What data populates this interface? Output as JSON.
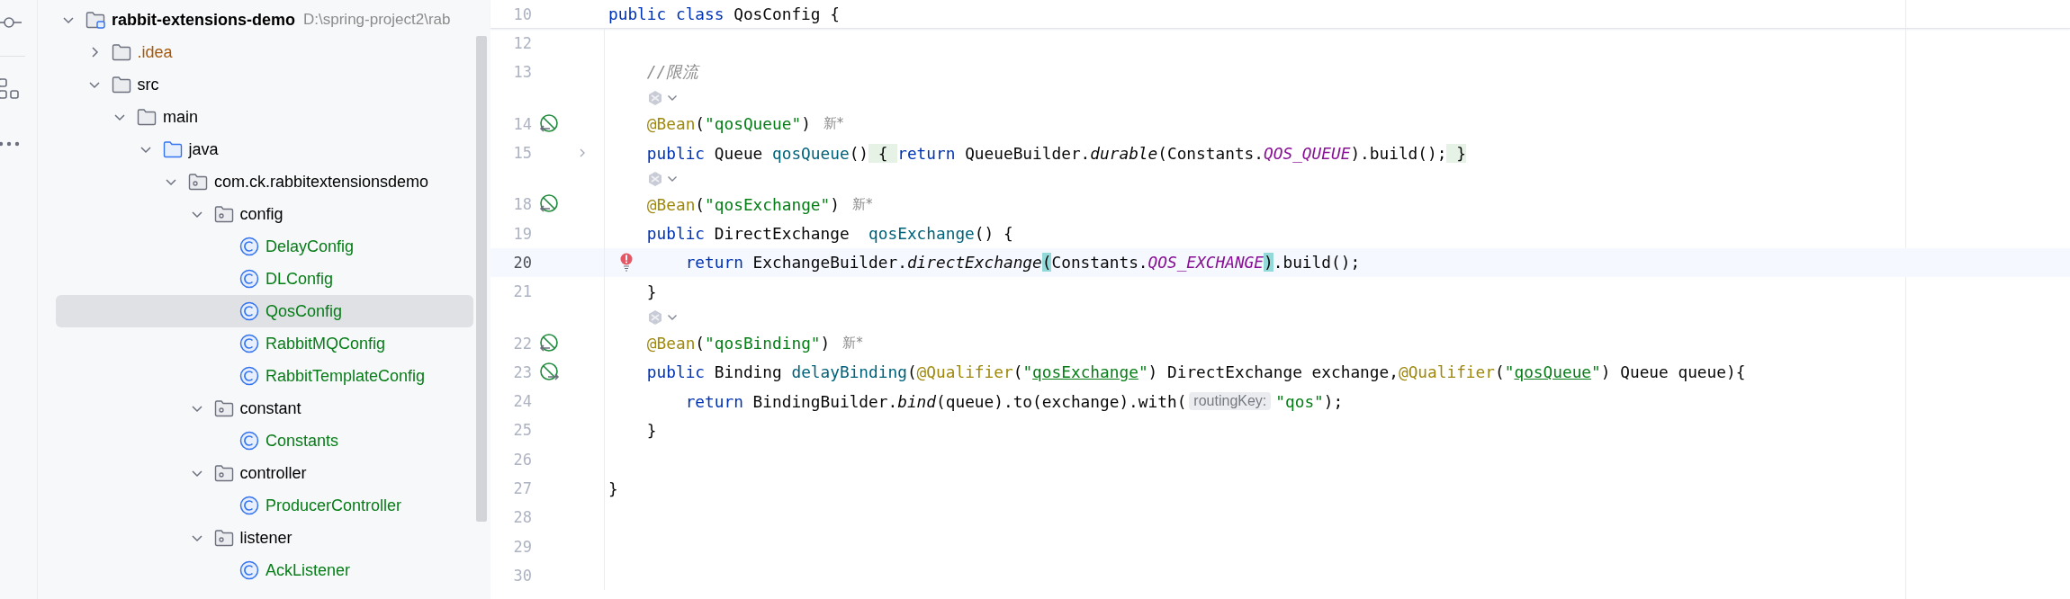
{
  "project_tree": {
    "root": {
      "name": "rabbit-extensions-demo",
      "path": "D:\\spring-project2\\rab",
      "kind": "module",
      "expanded": true,
      "selected": false,
      "children": [
        {
          "name": ".idea",
          "kind": "folder",
          "color": "#a6580a",
          "expanded": false,
          "selected": false
        },
        {
          "name": "src",
          "kind": "folder",
          "expanded": true,
          "selected": false,
          "children": [
            {
              "name": "main",
              "kind": "folder",
              "expanded": true,
              "selected": false,
              "children": [
                {
                  "name": "java",
                  "kind": "source-root",
                  "expanded": true,
                  "selected": false,
                  "children": [
                    {
                      "name": "com.ck.rabbitextensionsdemo",
                      "kind": "package",
                      "expanded": true,
                      "selected": false,
                      "children": [
                        {
                          "name": "config",
                          "kind": "package",
                          "expanded": true,
                          "selected": false,
                          "children": [
                            {
                              "name": "DelayConfig",
                              "kind": "class",
                              "color": "#067d17",
                              "selected": false
                            },
                            {
                              "name": "DLConfig",
                              "kind": "class",
                              "color": "#067d17",
                              "selected": false
                            },
                            {
                              "name": "QosConfig",
                              "kind": "class",
                              "color": "#067d17",
                              "selected": true
                            },
                            {
                              "name": "RabbitMQConfig",
                              "kind": "class",
                              "color": "#067d17",
                              "selected": false
                            },
                            {
                              "name": "RabbitTemplateConfig",
                              "kind": "class",
                              "color": "#067d17",
                              "selected": false
                            }
                          ]
                        },
                        {
                          "name": "constant",
                          "kind": "package",
                          "expanded": true,
                          "selected": false,
                          "children": [
                            {
                              "name": "Constants",
                              "kind": "class",
                              "color": "#067d17",
                              "selected": false
                            }
                          ]
                        },
                        {
                          "name": "controller",
                          "kind": "package",
                          "expanded": true,
                          "selected": false,
                          "children": [
                            {
                              "name": "ProducerController",
                              "kind": "class",
                              "color": "#067d17",
                              "selected": false
                            }
                          ]
                        },
                        {
                          "name": "listener",
                          "kind": "package",
                          "expanded": true,
                          "selected": false,
                          "children": [
                            {
                              "name": "AckListener",
                              "kind": "class",
                              "color": "#067d17",
                              "selected": false
                            }
                          ]
                        }
                      ]
                    }
                  ]
                }
              ]
            }
          ]
        }
      ]
    }
  },
  "editor": {
    "lines": [
      {
        "kind": "code",
        "number": "10",
        "sticky": true,
        "current": false,
        "folded": false,
        "tokens": [
          {
            "t": "public ",
            "kind": "kw"
          },
          {
            "t": "class ",
            "kind": "kw"
          },
          {
            "t": "QosConfig {",
            "kind": "id"
          }
        ]
      },
      {
        "kind": "code",
        "number": "12",
        "current": false,
        "folded": false
      },
      {
        "kind": "code",
        "number": "13",
        "current": false,
        "folded": false,
        "tokens": [
          {
            "t": "    //限流",
            "kind": "comment"
          }
        ]
      },
      {
        "kind": "inlay"
      },
      {
        "kind": "code",
        "number": "14",
        "marker": {
          "kind": "bean"
        },
        "current": false,
        "folded": false,
        "author": "新*",
        "tokens": [
          {
            "t": "    @Bean",
            "kind": "ann"
          },
          {
            "t": "(",
            "kind": "id"
          },
          {
            "t": "\"qosQueue\"",
            "kind": "str"
          },
          {
            "t": ")",
            "kind": "id"
          }
        ]
      },
      {
        "kind": "code",
        "number": "15",
        "current": false,
        "folded": true,
        "tokens": [
          {
            "t": "    public ",
            "kind": "kw"
          },
          {
            "t": "Queue ",
            "kind": "id"
          },
          {
            "t": "qosQueue",
            "kind": "fn"
          },
          {
            "t": "()",
            "kind": "id"
          },
          {
            "t": " { ",
            "kind": "brace"
          },
          {
            "t": "return ",
            "kind": "kw"
          },
          {
            "t": "QueueBuilder.",
            "kind": "id"
          },
          {
            "t": "durable",
            "kind": "call"
          },
          {
            "t": "(Constants.",
            "kind": "id"
          },
          {
            "t": "QOS_QUEUE",
            "kind": "const"
          },
          {
            "t": ").build();",
            "kind": "id"
          },
          {
            "t": " }",
            "kind": "brace"
          }
        ]
      },
      {
        "kind": "inlay"
      },
      {
        "kind": "code",
        "number": "18",
        "marker": {
          "kind": "bean"
        },
        "current": false,
        "folded": false,
        "author": "新*",
        "tokens": [
          {
            "t": "    @Bean",
            "kind": "ann"
          },
          {
            "t": "(",
            "kind": "id"
          },
          {
            "t": "\"qosExchange\"",
            "kind": "str"
          },
          {
            "t": ")",
            "kind": "id"
          }
        ]
      },
      {
        "kind": "code",
        "number": "19",
        "current": false,
        "folded": false,
        "tokens": [
          {
            "t": "    public ",
            "kind": "kw"
          },
          {
            "t": "DirectExchange  ",
            "kind": "id"
          },
          {
            "t": "qosExchange",
            "kind": "fn"
          },
          {
            "t": "() {",
            "kind": "id"
          }
        ]
      },
      {
        "kind": "code",
        "number": "20",
        "current": true,
        "error": true,
        "folded": false,
        "tokens": [
          {
            "t": "        return ",
            "kind": "kw"
          },
          {
            "t": "ExchangeBuilder.",
            "kind": "id"
          },
          {
            "t": "directExchange",
            "kind": "call"
          },
          {
            "t": "(",
            "kind": "paren"
          },
          {
            "t": "Constants.",
            "kind": "id"
          },
          {
            "t": "QOS_EXCHANGE",
            "kind": "const"
          },
          {
            "t": ")",
            "kind": "paren"
          },
          {
            "t": ".build();",
            "kind": "id"
          }
        ]
      },
      {
        "kind": "code",
        "number": "21",
        "current": false,
        "folded": false,
        "tokens": [
          {
            "t": "    }",
            "kind": "id"
          }
        ]
      },
      {
        "kind": "inlay"
      },
      {
        "kind": "code",
        "number": "22",
        "marker": {
          "kind": "bean"
        },
        "current": false,
        "folded": false,
        "author": "新*",
        "tokens": [
          {
            "t": "    @Bean",
            "kind": "ann"
          },
          {
            "t": "(",
            "kind": "id"
          },
          {
            "t": "\"qosBinding\"",
            "kind": "str"
          },
          {
            "t": ")",
            "kind": "id"
          }
        ]
      },
      {
        "kind": "code",
        "number": "23",
        "marker": {
          "kind": "bean-injection"
        },
        "current": false,
        "folded": false,
        "tokens": [
          {
            "t": "    public ",
            "kind": "kw"
          },
          {
            "t": "Binding ",
            "kind": "id"
          },
          {
            "t": "delayBinding",
            "kind": "fn"
          },
          {
            "t": "(",
            "kind": "id"
          },
          {
            "t": "@Qualifier",
            "kind": "ann"
          },
          {
            "t": "(",
            "kind": "id"
          },
          {
            "t": "\"",
            "kind": "str"
          },
          {
            "t": "qosExchange",
            "kind": "strlink"
          },
          {
            "t": "\"",
            "kind": "str"
          },
          {
            "t": ") DirectExchange exchange,",
            "kind": "id"
          },
          {
            "t": "@Qualifier",
            "kind": "ann"
          },
          {
            "t": "(",
            "kind": "id"
          },
          {
            "t": "\"",
            "kind": "str"
          },
          {
            "t": "qosQueue",
            "kind": "strlink"
          },
          {
            "t": "\"",
            "kind": "str"
          },
          {
            "t": ") Queue queue){",
            "kind": "id"
          }
        ]
      },
      {
        "kind": "code",
        "number": "24",
        "current": false,
        "folded": false,
        "tokens": [
          {
            "t": "        return ",
            "kind": "kw"
          },
          {
            "t": "BindingBuilder.",
            "kind": "id"
          },
          {
            "t": "bind",
            "kind": "call"
          },
          {
            "t": "(queue).to(exchange).with(",
            "kind": "id"
          },
          {
            "t": "routingKey:",
            "kind": "hint"
          },
          {
            "t": "\"qos\"",
            "kind": "str"
          },
          {
            "t": ");",
            "kind": "id"
          }
        ]
      },
      {
        "kind": "code",
        "number": "25",
        "current": false,
        "folded": false,
        "tokens": [
          {
            "t": "    }",
            "kind": "id"
          }
        ]
      },
      {
        "kind": "code",
        "number": "26",
        "current": false,
        "folded": false
      },
      {
        "kind": "code",
        "number": "27",
        "current": false,
        "folded": false,
        "tokens": [
          {
            "t": "}",
            "kind": "id"
          }
        ]
      },
      {
        "kind": "code",
        "number": "28",
        "current": false,
        "folded": false
      },
      {
        "kind": "code",
        "number": "29",
        "current": false,
        "folded": false
      },
      {
        "kind": "code",
        "number": "30",
        "current": false,
        "folded": false
      }
    ]
  }
}
